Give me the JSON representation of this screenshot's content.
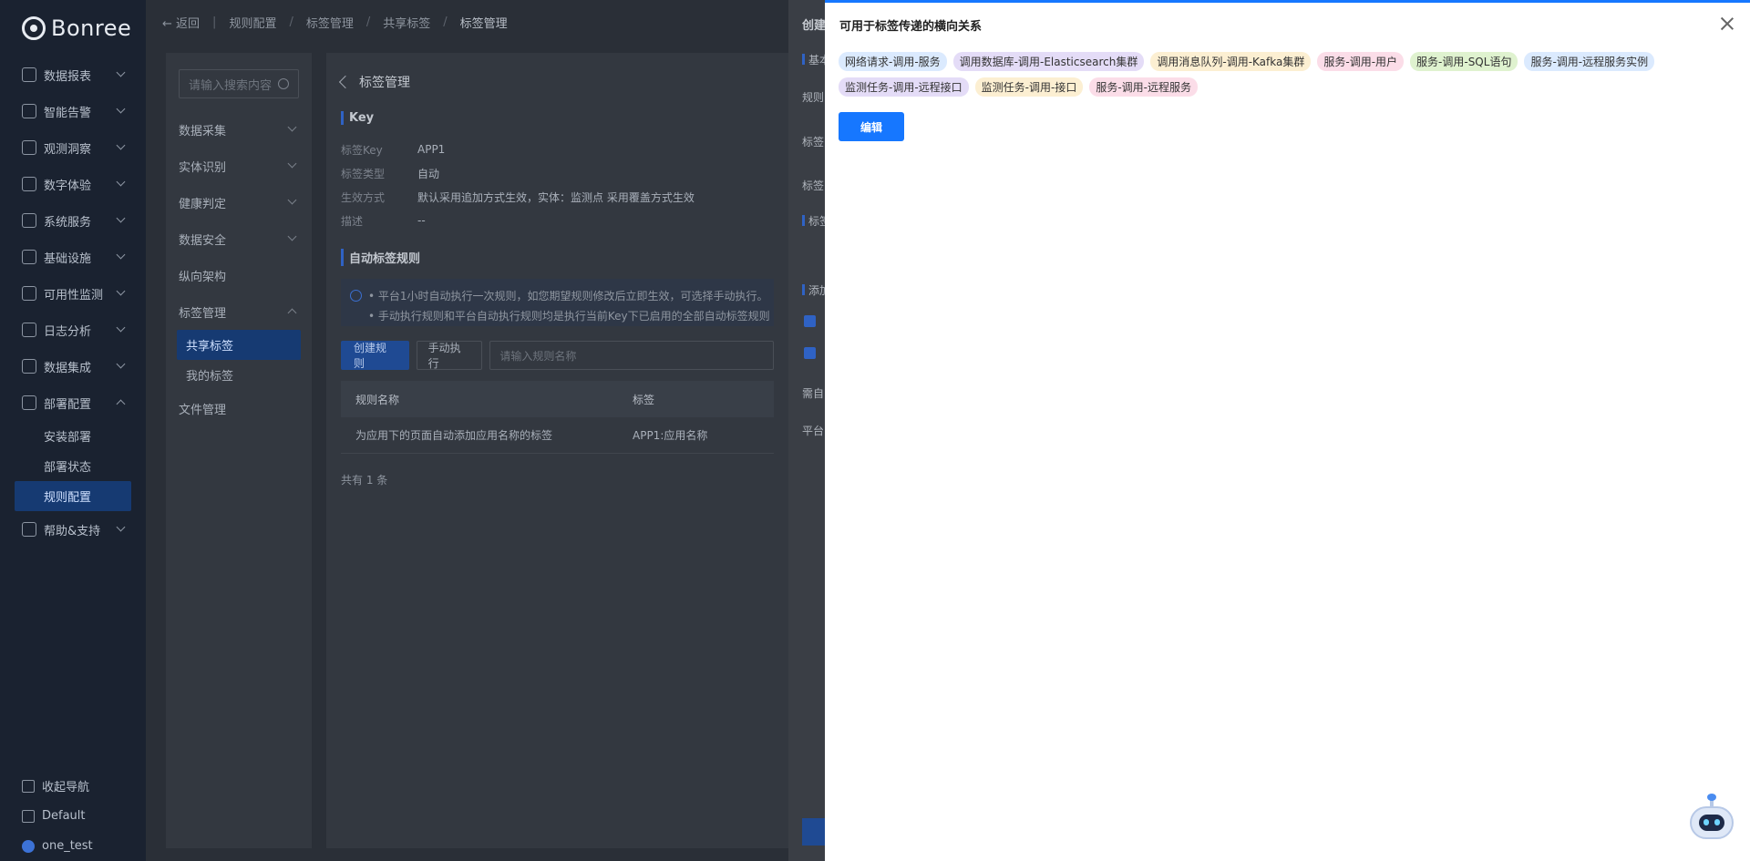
{
  "nav": {
    "brand": "Bonree",
    "items": [
      {
        "label": "数据报表",
        "icon": "chart-icon"
      },
      {
        "label": "智能告警",
        "icon": "bell-icon"
      },
      {
        "label": "观测洞察",
        "icon": "eye-icon"
      },
      {
        "label": "数字体验",
        "icon": "user-icon"
      },
      {
        "label": "系统服务",
        "icon": "server-icon"
      },
      {
        "label": "基础设施",
        "icon": "infra-icon"
      },
      {
        "label": "可用性监测",
        "icon": "monitor-icon"
      },
      {
        "label": "日志分析",
        "icon": "log-icon"
      },
      {
        "label": "数据集成",
        "icon": "integration-icon"
      },
      {
        "label": "部署配置",
        "icon": "wrench-icon"
      }
    ],
    "deploy_sub": [
      "安装部署",
      "部署状态",
      "规则配置"
    ],
    "help": "帮助&支持",
    "collapse": "收起导航",
    "workspace": "Default",
    "user": "one_test"
  },
  "breadcrumb": {
    "back": "返回",
    "items": [
      "规则配置",
      "标签管理",
      "共享标签",
      "标签管理"
    ]
  },
  "subnav": {
    "search_placeholder": "请输入搜索内容",
    "items": [
      "数据采集",
      "实体识别",
      "健康判定",
      "数据安全",
      "纵向架构",
      "标签管理"
    ],
    "tag_sub": [
      "共享标签",
      "我的标签"
    ],
    "file": "文件管理"
  },
  "content": {
    "title": "标签管理",
    "key_section": "Key",
    "fields": [
      {
        "k": "标签Key",
        "v": "APP1"
      },
      {
        "k": "标签类型",
        "v": "自动"
      },
      {
        "k": "生效方式",
        "v": "默认采用追加方式生效，实体：监测点 采用覆盖方式生效"
      },
      {
        "k": "描述",
        "v": "--"
      }
    ],
    "rule_section": "自动标签规则",
    "notice_1": "• 平台1小时自动执行一次规则，如您期望规则修改后立即生效，可选择手动执行。",
    "notice_2": "• 手动执行规则和平台自动执行规则均是执行当前Key下已启用的全部自动标签规则",
    "create_btn": "创建规则",
    "run_btn": "手动执行",
    "rule_search_placeholder": "请输入规则名称",
    "table_headers": [
      "规则名称",
      "标签"
    ],
    "rows": [
      [
        "为应用下的页面自动添加应用名称的标签",
        "APP1:应用名称"
      ]
    ],
    "total": "共有 1 条"
  },
  "mid_drawer": {
    "title": "创建",
    "labels": [
      "基本",
      "规则",
      "标签",
      "标签",
      "标签",
      "添加",
      "需自",
      "平台"
    ]
  },
  "drawer": {
    "title": "可用于标签传递的横向关系",
    "tags": [
      {
        "label": "网络请求-调用-服务",
        "color": "#dbeafe"
      },
      {
        "label": "调用数据库-调用-Elasticsearch集群",
        "color": "#e4dcf7"
      },
      {
        "label": "调用消息队列-调用-Kafka集群",
        "color": "#fcefd2"
      },
      {
        "label": "服务-调用-用户",
        "color": "#fbdde8"
      },
      {
        "label": "服务-调用-SQL语句",
        "color": "#dff2cf"
      },
      {
        "label": "服务-调用-远程服务实例",
        "color": "#dbeafe"
      },
      {
        "label": "监测任务-调用-远程接口",
        "color": "#e4dcf7"
      },
      {
        "label": "监测任务-调用-接口",
        "color": "#fcefd2"
      },
      {
        "label": "服务-调用-远程服务",
        "color": "#fbdde8"
      }
    ],
    "edit_label": "编辑"
  },
  "colors": {
    "primary": "#1677ff",
    "nav_bg": "#1a2230",
    "active_bg": "#163a72"
  }
}
